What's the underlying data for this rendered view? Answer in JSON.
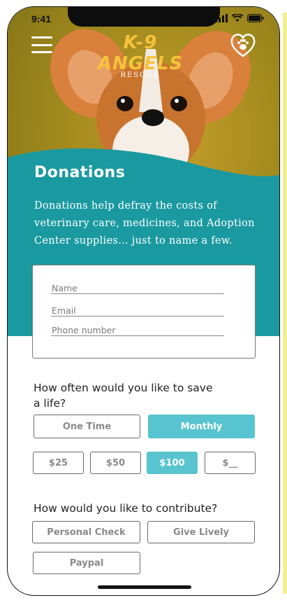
{
  "status": {
    "time": "9:41"
  },
  "header": {
    "logo_main": "K-9 ANGELS",
    "logo_sub": "RESCUE"
  },
  "hero": {
    "title": "Donations",
    "description": "Donations help defray the costs of veterinary care, medicines, and Adoption Center supplies... just to name a few."
  },
  "form": {
    "name_placeholder": "Name",
    "email_placeholder": "Email",
    "phone_placeholder": "Phone number"
  },
  "frequency": {
    "question": "How often would you like to save a life?",
    "options": [
      "One Time",
      "Monthly"
    ],
    "selected": "Monthly"
  },
  "amounts": {
    "options": [
      "$25",
      "$50",
      "$100",
      "$__"
    ],
    "selected": "$100"
  },
  "contribute": {
    "question": "How would you like to contribute?",
    "options": [
      "Personal Check",
      "Give Lively",
      "Paypal"
    ]
  },
  "colors": {
    "teal": "#1a9aa0",
    "accent": "#58c4cf",
    "logo_yellow": "#f5c33b"
  },
  "icons": [
    "hamburger-menu-icon",
    "heart-paw-icon",
    "signal-icon",
    "wifi-icon",
    "battery-icon"
  ]
}
